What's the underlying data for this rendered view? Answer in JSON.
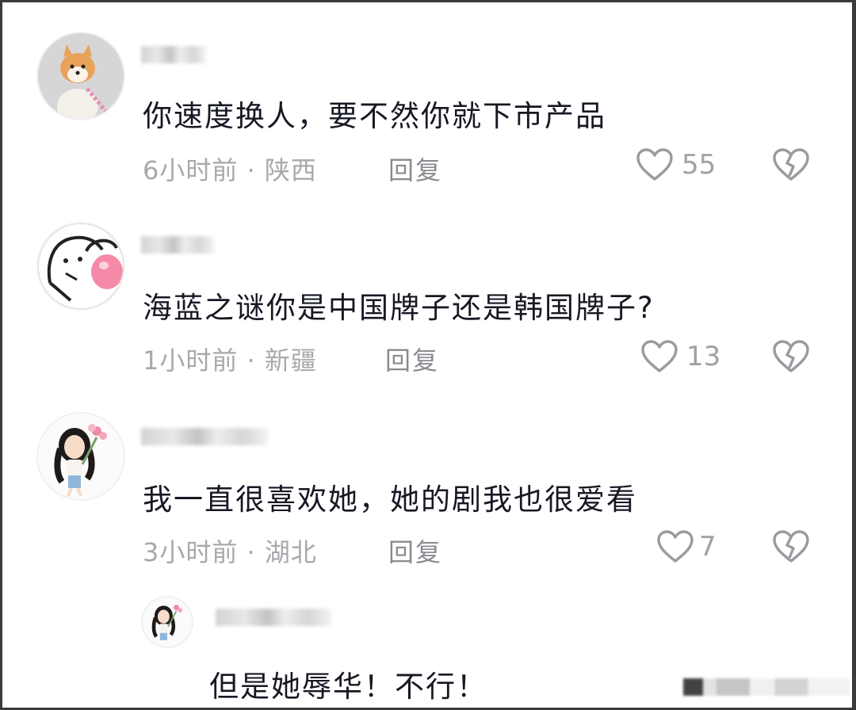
{
  "comments": [
    {
      "text": "你速度换人，要不然你就下市产品",
      "time": "6小时前",
      "location": "陕西",
      "reply_label": "回复",
      "likes": "55"
    },
    {
      "text": "海蓝之谜你是中国牌子还是韩国牌子?",
      "time": "1小时前",
      "location": "新疆",
      "reply_label": "回复",
      "likes": "13"
    },
    {
      "text": "我一直很喜欢她，她的剧我也很爱看",
      "time": "3小时前",
      "location": "湖北",
      "reply_label": "回复",
      "likes": "7"
    }
  ],
  "sub_reply": {
    "text": "但是她辱华！不行！"
  },
  "icons": {
    "like": "heart-outline-icon",
    "dislike": "broken-heart-icon"
  },
  "colors": {
    "text": "#161823",
    "meta": "#a8a8ad",
    "icon": "#9a9aa0"
  }
}
